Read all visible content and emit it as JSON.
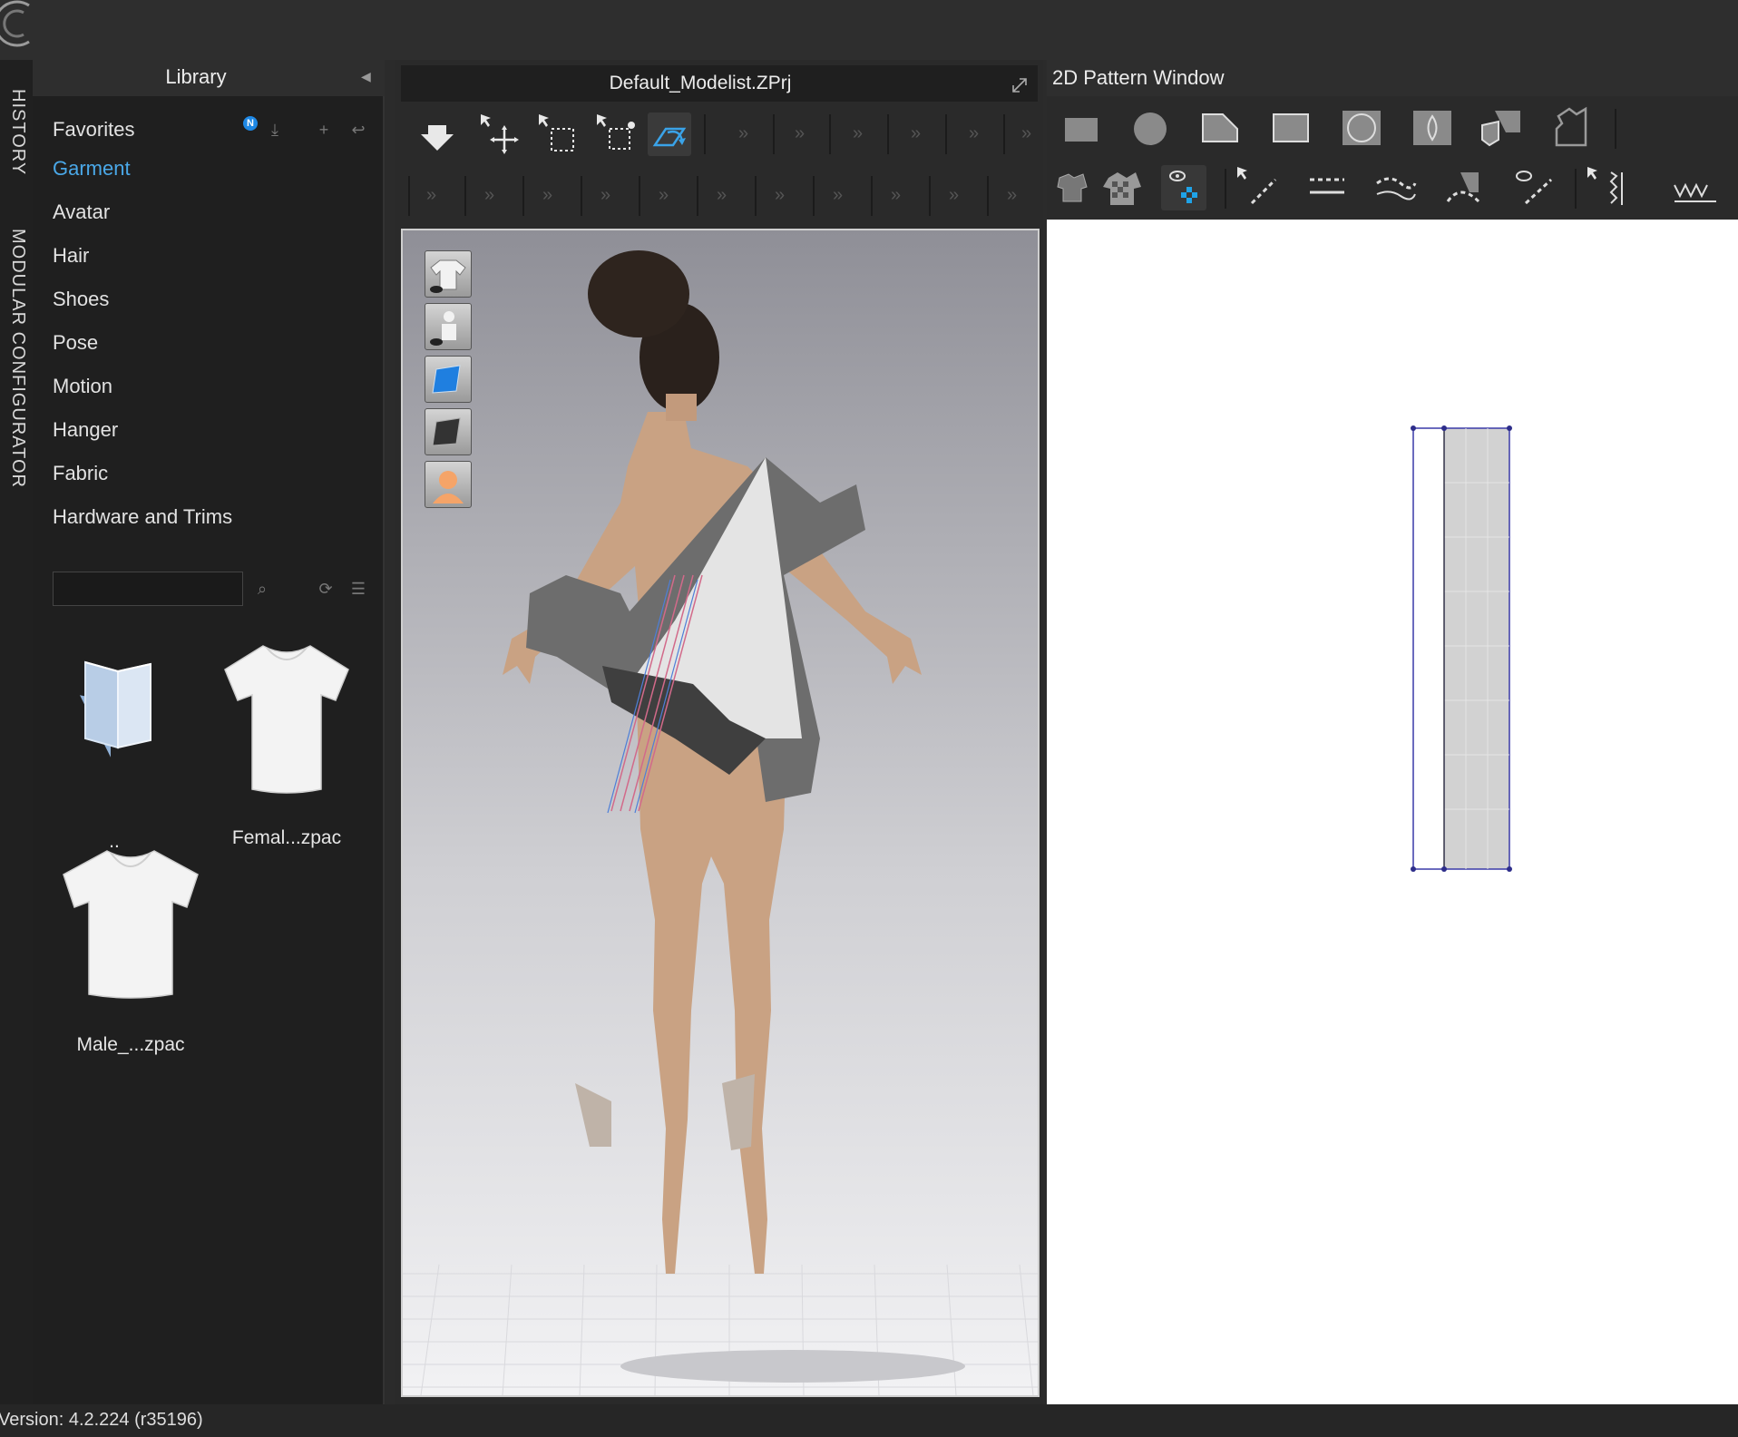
{
  "sidebar_tabs": [
    "HISTORY",
    "MODULAR CONFIGURATOR"
  ],
  "library": {
    "title": "Library",
    "badge": "N",
    "items": [
      {
        "label": "Favorites",
        "active": false
      },
      {
        "label": "Garment",
        "active": true
      },
      {
        "label": "Avatar",
        "active": false
      },
      {
        "label": "Hair",
        "active": false
      },
      {
        "label": "Shoes",
        "active": false
      },
      {
        "label": "Pose",
        "active": false
      },
      {
        "label": "Motion",
        "active": false
      },
      {
        "label": "Hanger",
        "active": false
      },
      {
        "label": "Fabric",
        "active": false
      },
      {
        "label": "Hardware and Trims",
        "active": false
      }
    ],
    "search": {
      "value": "",
      "placeholder": ""
    },
    "files": [
      {
        "label": "..",
        "icon": "folder-icon"
      },
      {
        "label": "Femal...zpac",
        "icon": "tshirt-icon"
      },
      {
        "label": "Male_...zpac",
        "icon": "tshirt-icon"
      }
    ]
  },
  "viewport": {
    "title": "Default_Modelist.ZPrj",
    "left_buttons": [
      "garment-visibility-icon",
      "avatar-visibility-icon",
      "texture-view-icon",
      "surface-view-icon",
      "avatar-skin-icon"
    ]
  },
  "pattern_window": {
    "title": "2D Pattern Window"
  },
  "status": {
    "version": "Version: 4.2.224 (r35196)"
  },
  "colors": {
    "accent": "#4aa8e8",
    "panel": "#1f1f1f",
    "pattern_fill": "#d2d2d2",
    "pattern_outline": "#3a3aa8"
  }
}
